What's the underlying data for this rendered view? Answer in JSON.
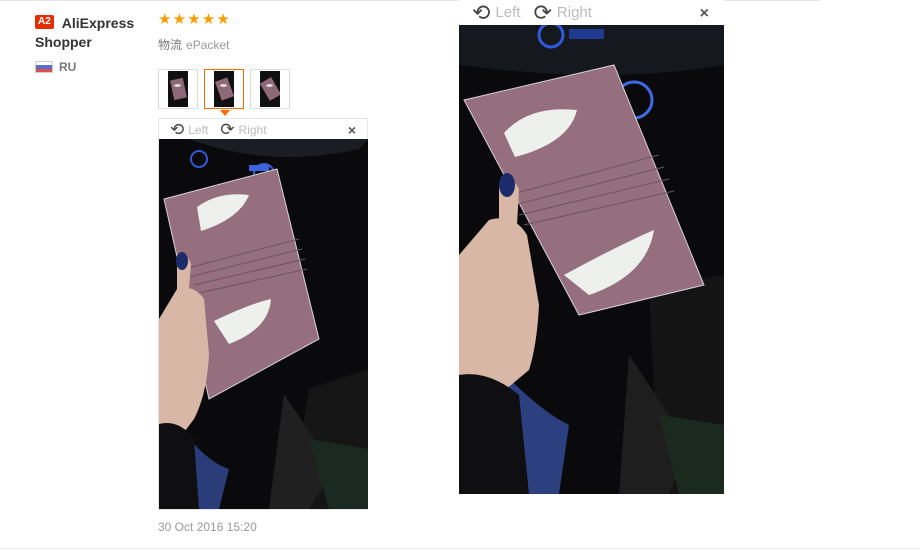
{
  "reviewer": {
    "level_badge": "A2",
    "name_line1": "AliExpress",
    "name_line2": "Shopper",
    "country_code": "RU",
    "flag": "russia-flag"
  },
  "review": {
    "rating": 5,
    "rating_max": 5,
    "shipping_label": "物流",
    "shipping_method": "ePacket",
    "date": "30 Oct 2016 15:20",
    "thumbnails": [
      {
        "name": "review-photo-1",
        "active": false
      },
      {
        "name": "review-photo-2",
        "active": true
      },
      {
        "name": "review-photo-3",
        "active": false
      }
    ]
  },
  "viewer": {
    "rotate_left_label": "Left",
    "rotate_right_label": "Right",
    "close_symbol": "×",
    "rotate_left_icon": "⟲",
    "rotate_right_icon": "⟳"
  },
  "colors": {
    "star": "#ff9a00",
    "badge": "#e62e04",
    "active_thumb": "#ff6a00"
  }
}
